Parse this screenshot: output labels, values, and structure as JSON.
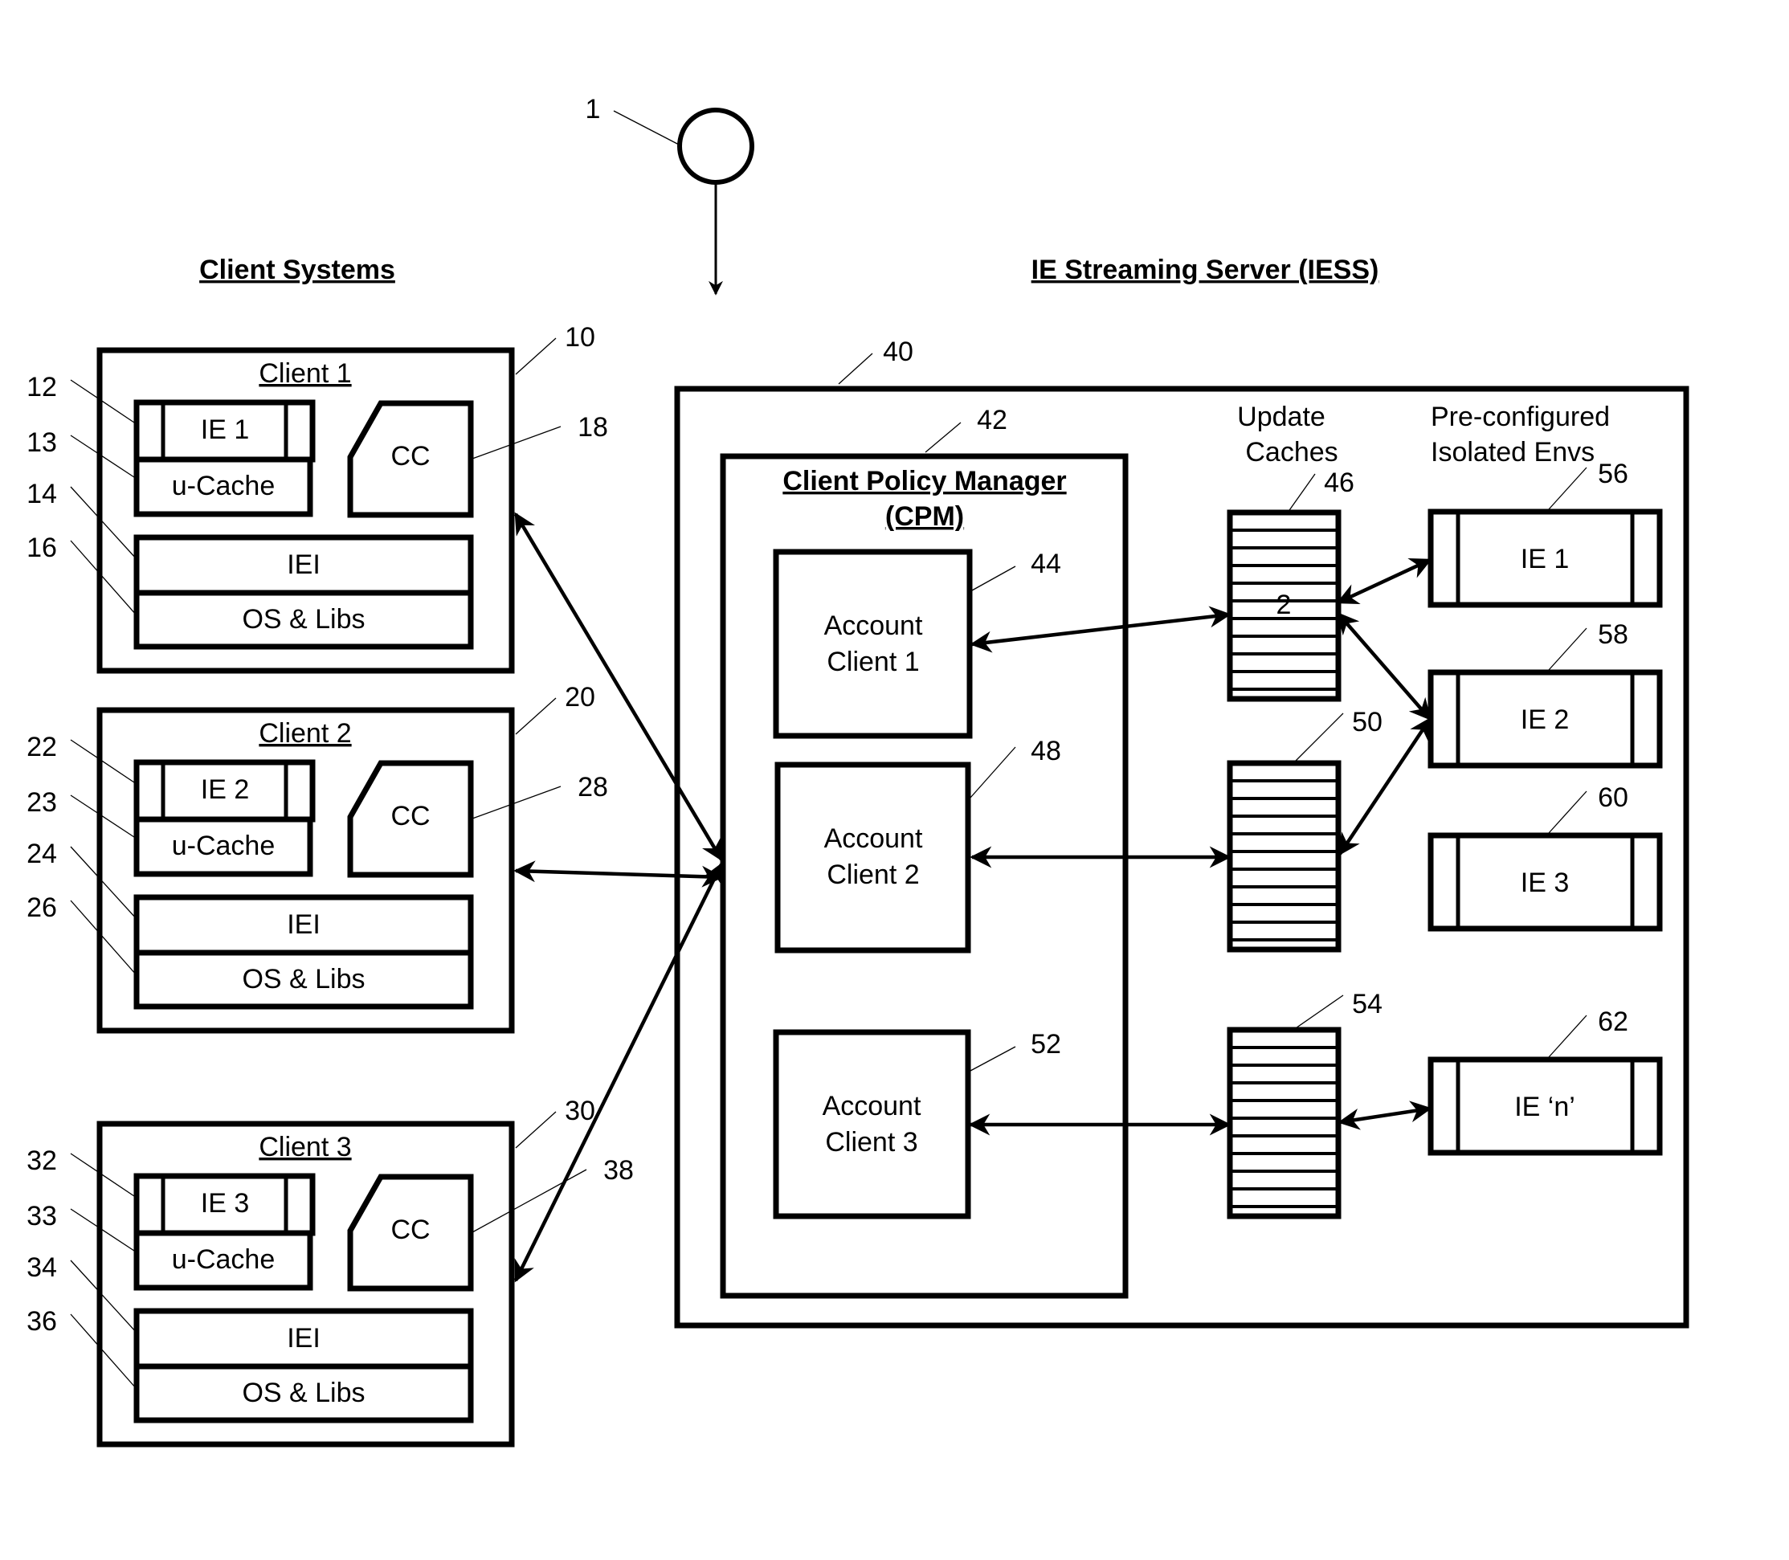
{
  "figure": {
    "headers": {
      "client_systems": "Client Systems",
      "server": "IE Streaming Server (IESS)"
    },
    "start_node": {
      "ref": "1"
    },
    "clients": [
      {
        "title": "Client 1",
        "ref": "10",
        "ie": "IE 1",
        "ie_ref": "12",
        "ucache": "u-Cache",
        "ucache_ref": "13",
        "iei": "IEI",
        "iei_ref": "14",
        "os": "OS & Libs",
        "os_ref": "16",
        "cc": "CC",
        "cc_ref": "18"
      },
      {
        "title": "Client 2",
        "ref": "20",
        "ie": "IE 2",
        "ie_ref": "22",
        "ucache": "u-Cache",
        "ucache_ref": "23",
        "iei": "IEI",
        "iei_ref": "24",
        "os": "OS & Libs",
        "os_ref": "26",
        "cc": "CC",
        "cc_ref": "28"
      },
      {
        "title": "Client 3",
        "ref": "30",
        "ie": "IE 3",
        "ie_ref": "32",
        "ucache": "u-Cache",
        "ucache_ref": "33",
        "iei": "IEI",
        "iei_ref": "34",
        "os": "OS & Libs",
        "os_ref": "36",
        "cc": "CC",
        "cc_ref": "38"
      }
    ],
    "server": {
      "ref": "40",
      "cpm": {
        "title_line1": "Client Policy Manager",
        "title_line2": "(CPM)",
        "ref": "42",
        "accounts": [
          {
            "line1": "Account",
            "line2": "Client 1",
            "ref": "44"
          },
          {
            "line1": "Account",
            "line2": "Client  2",
            "ref": "48"
          },
          {
            "line1": "Account",
            "line2": "Client 3",
            "ref": "52"
          }
        ]
      },
      "update_caches": {
        "title_line1": "Update",
        "title_line2": "Caches",
        "items": [
          {
            "ref": "46",
            "label": "2"
          },
          {
            "ref": "50",
            "label": ""
          },
          {
            "ref": "54",
            "label": ""
          }
        ]
      },
      "isolated_envs": {
        "title_line1": "Pre-configured",
        "title_line2": "Isolated Envs",
        "items": [
          {
            "label": "IE 1",
            "ref": "56"
          },
          {
            "label": "IE 2",
            "ref": "58"
          },
          {
            "label": "IE 3",
            "ref": "60"
          },
          {
            "label": "IE ‘n’",
            "ref": "62"
          }
        ]
      }
    }
  }
}
